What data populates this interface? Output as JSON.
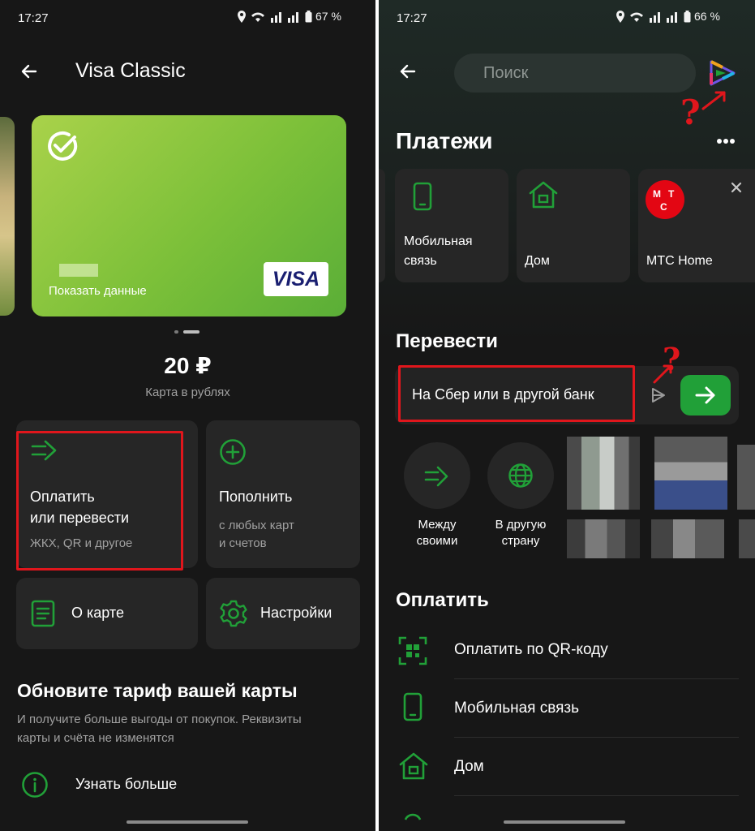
{
  "left": {
    "status": {
      "time": "17:27",
      "battery": "67 %"
    },
    "header": {
      "title": "Visa Classic"
    },
    "card": {
      "show_data_label": "Показать данные",
      "brand": "VISA"
    },
    "balance": {
      "amount": "20 ₽",
      "caption": "Карта в рублях"
    },
    "tiles": {
      "pay": {
        "title_line1": "Оплатить",
        "title_line2": "или перевести",
        "subtitle": "ЖКХ, QR и другое"
      },
      "topup": {
        "title": "Пополнить",
        "subtitle_line1": "с любых карт",
        "subtitle_line2": "и счетов"
      },
      "about": {
        "title": "О карте"
      },
      "settings": {
        "title": "Настройки"
      }
    },
    "tariff": {
      "heading": "Обновите тариф вашей карты",
      "desc_line1": "И получите больше выгоды от покупок. Реквизиты",
      "desc_line2": "карты и счёта не изменятся",
      "learn_more": "Узнать больше"
    }
  },
  "right": {
    "status": {
      "time": "17:27",
      "battery": "66 %"
    },
    "search": {
      "placeholder": "Поиск"
    },
    "annotation_mark": "?",
    "payments": {
      "heading": "Платежи",
      "items": [
        {
          "label_line1": "Мобильная",
          "label_line2": "связь",
          "icon": "phone-icon"
        },
        {
          "label_line1": "Дом",
          "label_line2": "",
          "icon": "house-icon"
        },
        {
          "label_line1": "МТС Home",
          "label_line2": "",
          "icon": "mts-logo",
          "logo_letters": [
            "М",
            "Т",
            "С"
          ]
        }
      ]
    },
    "transfer": {
      "heading": "Перевести",
      "input_label": "На Сбер или в другой банк",
      "shortcuts": [
        {
          "line1": "Между",
          "line2": "своими",
          "icon": "arrows-icon"
        },
        {
          "line1": "В другую",
          "line2": "страну",
          "icon": "globe-icon"
        }
      ]
    },
    "pay_section": {
      "heading": "Оплатить",
      "rows": [
        {
          "label": "Оплатить по QR-коду",
          "icon": "qr-icon"
        },
        {
          "label": "Мобильная связь",
          "icon": "phone-icon"
        },
        {
          "label": "Дом",
          "icon": "house-icon"
        }
      ]
    }
  },
  "colors": {
    "accent": "#21a038",
    "highlight": "#e0161c",
    "background": "#171717",
    "tile": "#262626"
  }
}
